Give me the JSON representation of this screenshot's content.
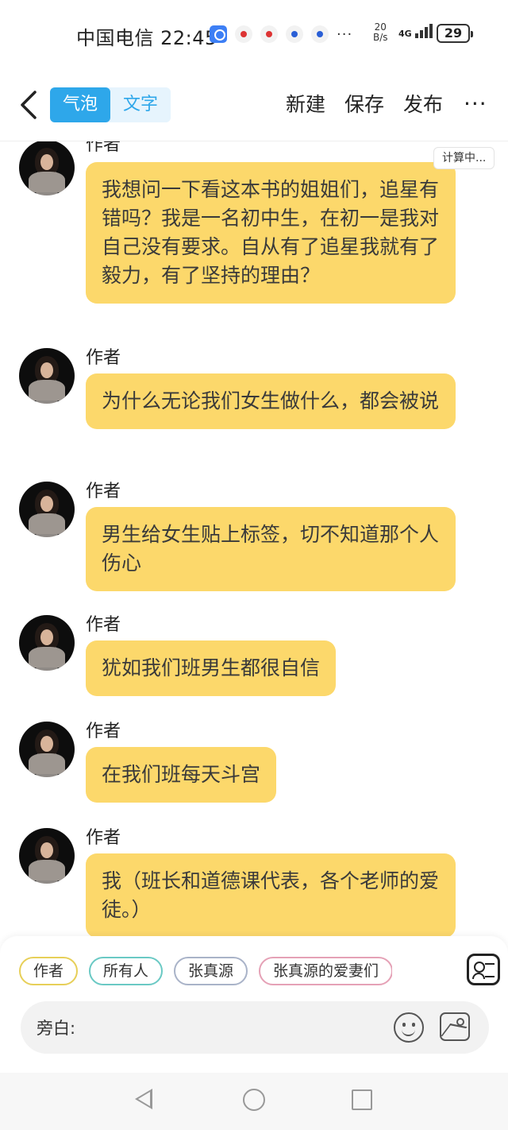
{
  "status_bar": {
    "carrier": "中国电信",
    "time": "22:45",
    "net_speed_value": "20",
    "net_speed_unit": "B/s",
    "network": "4G",
    "battery": "29",
    "more": "···"
  },
  "header": {
    "tabs": [
      {
        "label": "气泡",
        "active": true
      },
      {
        "label": "文字",
        "active": false
      }
    ],
    "actions": {
      "new": "新建",
      "save": "保存",
      "publish": "发布"
    },
    "more": "···"
  },
  "calc_tag": "计算中...",
  "messages": [
    {
      "sender": "作者",
      "text": "我想问一下看这本书的姐姐们，追星有错吗？我是一名初中生，在初一是我对自己没有要求。自从有了追星我就有了毅力，有了坚持的理由？"
    },
    {
      "sender": "作者",
      "text": "为什么无论我们女生做什么，都会被说"
    },
    {
      "sender": "作者",
      "text": "男生给女生贴上标签，切不知道那个人伤心"
    },
    {
      "sender": "作者",
      "text": "犹如我们班男生都很自信"
    },
    {
      "sender": "作者",
      "text": "在我们班每天斗宫"
    },
    {
      "sender": "作者",
      "text": "我（班长和道德课代表，各个老师的爱徒。）"
    }
  ],
  "roles": [
    {
      "label": "作者",
      "color": "#e7cf58"
    },
    {
      "label": "所有人",
      "color": "#6ac9c4"
    },
    {
      "label": "张真源",
      "color": "#a9b3c8"
    },
    {
      "label": "张真源的爱妻们",
      "color": "#e5a1b6"
    }
  ],
  "input": {
    "label": "旁白:"
  },
  "colors": {
    "accent": "#2ea7ea",
    "bubble": "#fcd86b"
  }
}
